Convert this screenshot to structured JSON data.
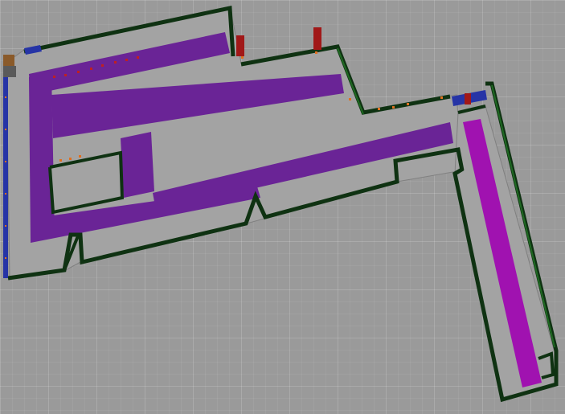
{
  "scene": {
    "name": "warehouse-floor-plan-3d-view",
    "colors": {
      "background": "#9a9a9a",
      "floor": "#a3a3a3",
      "floor_edge": "#7a7a7a",
      "wall": "#0f3212",
      "wall_highlight": "#1f6a22",
      "lane_purple": "#6a2496",
      "lane_magenta": "#a012b0",
      "conveyor_blue": "#2634a6",
      "rack_red": "#a11818",
      "marker_orange": "#e07020",
      "marker_red": "#c02020",
      "box_brown": "#8a5a2a"
    }
  }
}
